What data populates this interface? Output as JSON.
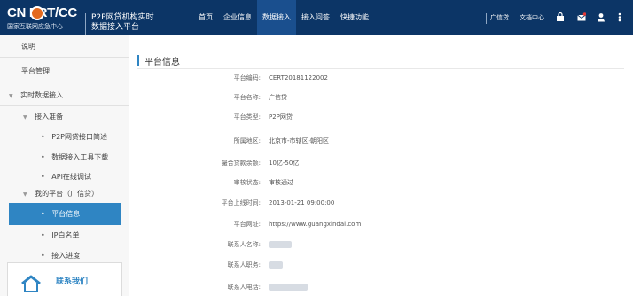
{
  "header": {
    "logo_text": "CN ERT/CC",
    "logo_subtitle": "国家互联网应急中心",
    "title_line1": "P2P网贷机构实时",
    "title_line2": "数据接入平台",
    "nav": [
      {
        "label": "首页",
        "active": false
      },
      {
        "label": "企业信息",
        "active": false
      },
      {
        "label": "数据接入",
        "active": true
      },
      {
        "label": "接入问答",
        "active": false
      },
      {
        "label": "快捷功能",
        "active": false
      }
    ],
    "user_name": "广信贷",
    "doc_center": "文档中心",
    "icons": [
      "lock-icon",
      "mail-icon",
      "user-icon",
      "more-icon"
    ]
  },
  "sidebar": {
    "items": [
      {
        "label": "说明",
        "level": 0,
        "caret": false,
        "active": false
      },
      {
        "label": "平台管理",
        "level": 0,
        "caret": false,
        "active": false
      },
      {
        "label": "实时数据接入",
        "level": 0,
        "caret": true,
        "active": false
      },
      {
        "label": "接入准备",
        "level": 1,
        "caret": true,
        "active": false
      },
      {
        "label": "P2P网贷接口简述",
        "level": 2,
        "caret": false,
        "active": false
      },
      {
        "label": "数据接入工具下载",
        "level": 2,
        "caret": false,
        "active": false
      },
      {
        "label": "API在线调试",
        "level": 2,
        "caret": false,
        "active": false
      },
      {
        "label": "我的平台（广信贷）",
        "level": 1,
        "caret": true,
        "active": false
      },
      {
        "label": "平台信息",
        "level": 2,
        "caret": false,
        "active": true
      },
      {
        "label": "IP白名单",
        "level": 2,
        "caret": false,
        "active": false
      },
      {
        "label": "接入进度",
        "level": 2,
        "caret": false,
        "active": false
      }
    ],
    "contact_label": "联系我们"
  },
  "main": {
    "section_title": "平台信息",
    "fields": [
      {
        "label": "平台编码:",
        "value": "CERT20181122002",
        "redacted": false
      },
      {
        "label": "平台名称:",
        "value": "广信贷",
        "redacted": false
      },
      {
        "label": "平台类型:",
        "value": "P2P网贷",
        "redacted": false
      },
      {
        "label": "所属地区:",
        "value": "北京市-市辖区-朝阳区",
        "redacted": false
      },
      {
        "label": "撮合贷款余额:",
        "value": "10亿-50亿",
        "redacted": false
      },
      {
        "label": "审核状态:",
        "value": "审核通过",
        "redacted": false
      },
      {
        "label": "平台上线时间:",
        "value": "2013-01-21 09:00:00",
        "redacted": false
      },
      {
        "label": "平台网址:",
        "value": "https://www.guangxindai.com",
        "redacted": false
      },
      {
        "label": "联系人名称:",
        "value": "",
        "redacted": true
      },
      {
        "label": "联系人职务:",
        "value": "",
        "redacted": true
      },
      {
        "label": "联系人电话:",
        "value": "",
        "redacted": true
      }
    ]
  },
  "colors": {
    "header_bg": "#0c3566",
    "nav_active_bg": "#1a4f8e",
    "accent": "#2f85c3",
    "logo_orange": "#e46a1f"
  }
}
